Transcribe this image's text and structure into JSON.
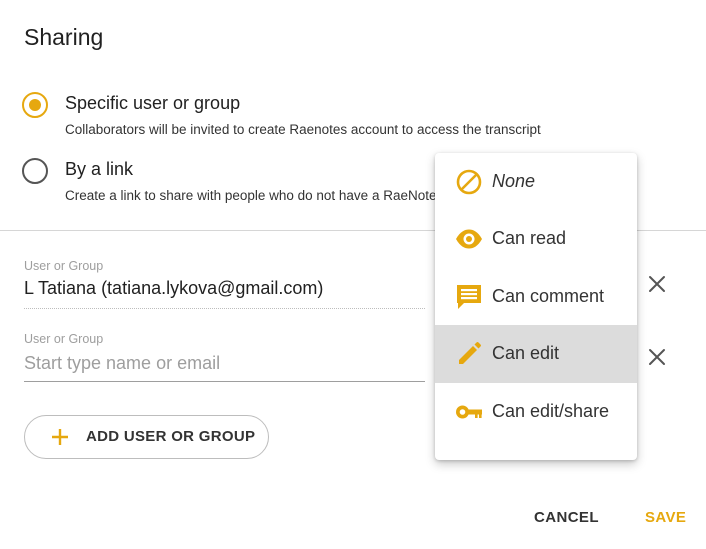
{
  "dialog": {
    "title": "Sharing"
  },
  "share_mode": {
    "selected": "specific",
    "options": [
      {
        "label": "Specific user or group",
        "description": "Collaborators will be invited to create Raenotes account to access the transcript"
      },
      {
        "label": "By a link",
        "description": "Create a link to share with people who do not have a RaeNotes account"
      }
    ]
  },
  "collaborators": [
    {
      "field_label": "User or Group",
      "value": "L Tatiana (tatiana.lykova@gmail.com)"
    },
    {
      "field_label": "User or Group",
      "value": "",
      "placeholder": "Start type name or email"
    }
  ],
  "add_button": {
    "label": "ADD USER OR GROUP"
  },
  "permission_menu": {
    "selected": "Can edit",
    "items": [
      {
        "label": "None",
        "icon": "block-icon"
      },
      {
        "label": "Can read",
        "icon": "eye-icon"
      },
      {
        "label": "Can comment",
        "icon": "comment-icon"
      },
      {
        "label": "Can edit",
        "icon": "pencil-icon"
      },
      {
        "label": "Can edit/share",
        "icon": "key-icon"
      }
    ]
  },
  "footer": {
    "cancel_label": "CANCEL",
    "save_label": "SAVE"
  },
  "colors": {
    "accent": "#e6a80f",
    "text": "#212121",
    "muted": "#9e9e9e",
    "selected_row": "#dcdcdc"
  }
}
